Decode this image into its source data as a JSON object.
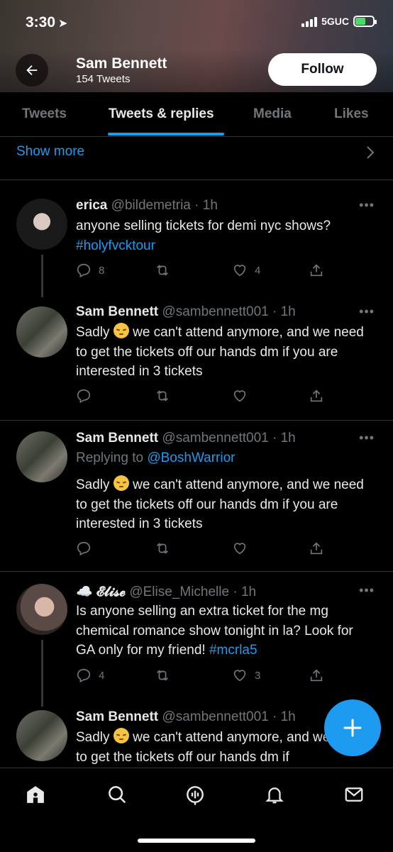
{
  "status": {
    "time": "3:30",
    "network": "5GUC"
  },
  "header": {
    "name": "Sam Bennett",
    "tweet_count": "154 Tweets",
    "follow_label": "Follow"
  },
  "tabs": [
    "Tweets",
    "Tweets & replies",
    "Media",
    "Likes"
  ],
  "show_more": "Show more",
  "tweets": [
    {
      "name": "erica",
      "handle": "@bildemetria · 1h",
      "text": "anyone selling tickets for demi nyc shows?",
      "hashtag": "#holyfvcktour",
      "replies": "8",
      "retweets": "",
      "likes": "4"
    },
    {
      "name": "Sam Bennett",
      "handle": "@sambennett001 · 1h",
      "text_pre": "Sadly",
      "text_post": "we can't attend anymore, and we need to get the tickets off our hands dm if you are interested in 3 tickets"
    },
    {
      "name": "Sam Bennett",
      "handle": "@sambennett001 · 1h",
      "replying_prefix": "Replying to",
      "replying_to": "@BoshWarrior",
      "text_pre": "Sadly",
      "text_post": "we can't attend anymore, and we need to get the tickets off our hands dm if you are interested in 3 tickets"
    },
    {
      "name": "☁️ 𝓔𝓵𝓲𝓼𝓮",
      "handle": "@Elise_Michelle · 1h",
      "text": "Is anyone selling an extra ticket for the mg chemical romance show tonight in la? Look for GA only for my friend!",
      "hashtag": "#mcrla5",
      "replies": "4",
      "likes": "3"
    },
    {
      "name": "Sam Bennett",
      "handle": "@sambennett001 · 1h",
      "text_pre": "Sadly",
      "text_post": "we can't attend anymore, and we need to get the tickets off our hands dm if"
    }
  ],
  "bottom_nav": [
    "home-icon",
    "search-icon",
    "spaces-icon",
    "notifications-icon",
    "messages-icon"
  ],
  "colors": {
    "accent": "#1d9bf0",
    "muted": "#71767b",
    "background": "#000000"
  }
}
